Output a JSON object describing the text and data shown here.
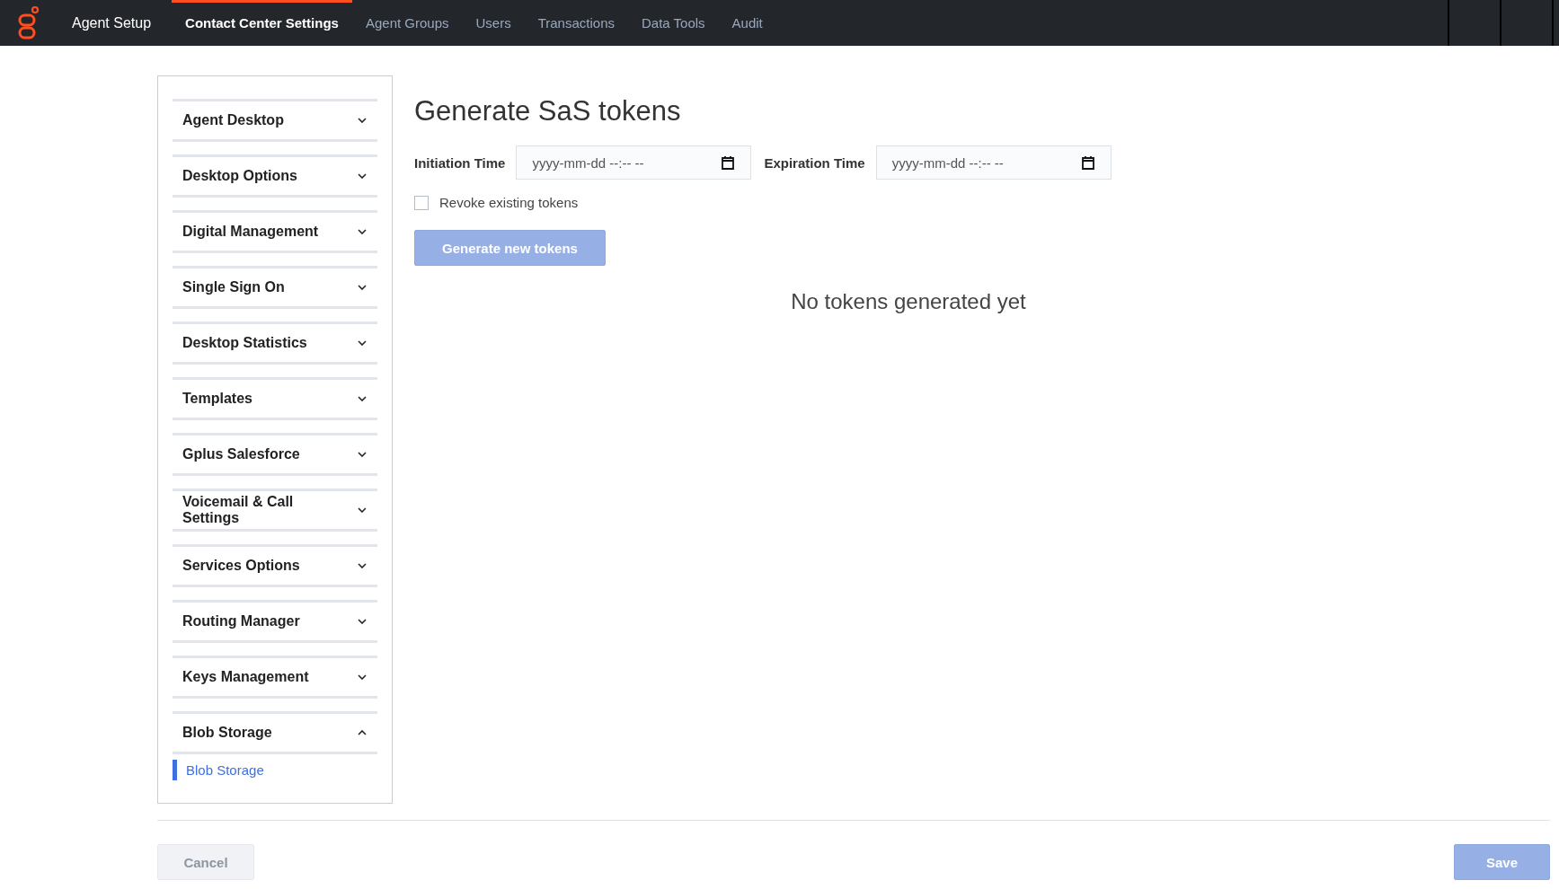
{
  "app": {
    "title": "Agent Setup"
  },
  "nav": [
    {
      "label": "Contact Center Settings",
      "selected": true
    },
    {
      "label": "Agent Groups",
      "selected": false
    },
    {
      "label": "Users",
      "selected": false
    },
    {
      "label": "Transactions",
      "selected": false
    },
    {
      "label": "Data Tools",
      "selected": false
    },
    {
      "label": "Audit",
      "selected": false
    }
  ],
  "sidebar": {
    "sections": [
      {
        "label": "Agent Desktop",
        "expanded": false
      },
      {
        "label": "Desktop Options",
        "expanded": false
      },
      {
        "label": "Digital Management",
        "expanded": false
      },
      {
        "label": "Single Sign On",
        "expanded": false
      },
      {
        "label": "Desktop Statistics",
        "expanded": false
      },
      {
        "label": "Templates",
        "expanded": false
      },
      {
        "label": "Gplus Salesforce",
        "expanded": false
      },
      {
        "label": "Voicemail & Call Settings",
        "expanded": false
      },
      {
        "label": "Services Options",
        "expanded": false
      },
      {
        "label": "Routing Manager",
        "expanded": false
      },
      {
        "label": "Keys Management",
        "expanded": false
      },
      {
        "label": "Blob Storage",
        "expanded": true,
        "children": [
          {
            "label": "Blob Storage",
            "selected": true
          }
        ]
      }
    ]
  },
  "main": {
    "title": "Generate SaS tokens",
    "fields": [
      {
        "label": "Initiation Time",
        "value": "yyyy-mm-dd --:-- --"
      },
      {
        "label": "Expiration Time",
        "value": "yyyy-mm-dd --:-- --"
      }
    ],
    "revoke": {
      "label": "Revoke existing tokens",
      "checked": false
    },
    "generate_button": {
      "label": "Generate new tokens",
      "disabled": true
    },
    "empty_message": "No tokens generated yet"
  },
  "footer": {
    "cancel": {
      "label": "Cancel",
      "disabled": true
    },
    "save": {
      "label": "Save",
      "disabled": true
    }
  }
}
